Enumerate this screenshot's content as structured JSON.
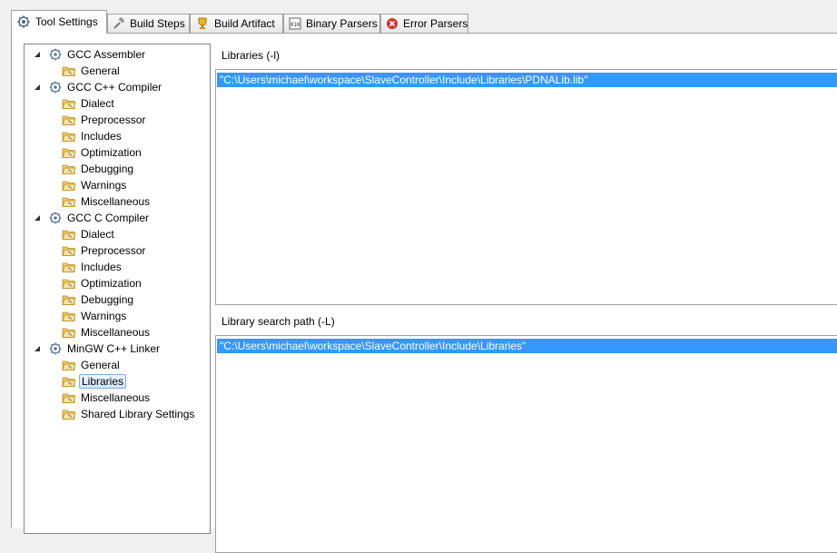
{
  "tabs": [
    {
      "label": "Tool Settings",
      "icon": "gear-icon",
      "active": true
    },
    {
      "label": "Build Steps",
      "icon": "hammer-icon"
    },
    {
      "label": "Build Artifact",
      "icon": "trophy-icon"
    },
    {
      "label": "Binary Parsers",
      "icon": "binary-icon"
    },
    {
      "label": "Error Parsers",
      "icon": "error-icon"
    }
  ],
  "tree": [
    {
      "label": "GCC Assembler",
      "level": 0,
      "expanded": true
    },
    {
      "label": "General",
      "level": 1
    },
    {
      "label": "GCC C++ Compiler",
      "level": 0,
      "expanded": true
    },
    {
      "label": "Dialect",
      "level": 1
    },
    {
      "label": "Preprocessor",
      "level": 1
    },
    {
      "label": "Includes",
      "level": 1
    },
    {
      "label": "Optimization",
      "level": 1
    },
    {
      "label": "Debugging",
      "level": 1
    },
    {
      "label": "Warnings",
      "level": 1
    },
    {
      "label": "Miscellaneous",
      "level": 1
    },
    {
      "label": "GCC C Compiler",
      "level": 0,
      "expanded": true
    },
    {
      "label": "Dialect",
      "level": 1
    },
    {
      "label": "Preprocessor",
      "level": 1
    },
    {
      "label": "Includes",
      "level": 1
    },
    {
      "label": "Optimization",
      "level": 1
    },
    {
      "label": "Debugging",
      "level": 1
    },
    {
      "label": "Warnings",
      "level": 1
    },
    {
      "label": "Miscellaneous",
      "level": 1
    },
    {
      "label": "MinGW C++ Linker",
      "level": 0,
      "expanded": true
    },
    {
      "label": "General",
      "level": 1
    },
    {
      "label": "Libraries",
      "level": 1,
      "selected": true
    },
    {
      "label": "Miscellaneous",
      "level": 1
    },
    {
      "label": "Shared Library Settings",
      "level": 1
    }
  ],
  "libraries": {
    "title": "Libraries (-l)",
    "items": [
      "\"C:\\Users\\michael\\workspace\\SlaveController\\Include\\Libraries\\PDNALib.lib\""
    ]
  },
  "search_path": {
    "title": "Library search path (-L)",
    "items": [
      "\"C:\\Users\\michael\\workspace\\SlaveController\\Include\\Libraries\""
    ]
  },
  "colors": {
    "selection": "#3399ff",
    "border": "#a0a0a0"
  }
}
